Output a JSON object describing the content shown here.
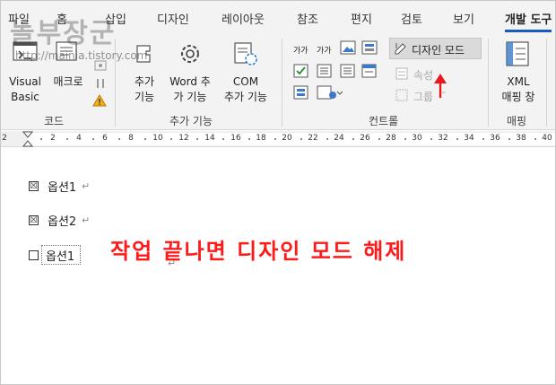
{
  "tabs": [
    "파일",
    "홈",
    "삽입",
    "디자인",
    "레이아웃",
    "참조",
    "편지",
    "검토",
    "보기",
    "개발 도구"
  ],
  "active_tab": "개발 도구",
  "watermark": {
    "title": "놀부장군",
    "url": "http://mainia.tistory.com"
  },
  "groups": {
    "code": {
      "label": "코드",
      "visual_basic": "Visual\nBasic",
      "macro": "매크로"
    },
    "addins": {
      "label": "추가 기능",
      "addins_btn": "추가\n기능",
      "word_addins_btn": "Word 추\n가 기능",
      "com_addins_btn": "COM\n추가 기능"
    },
    "controls": {
      "label": "컨트롤",
      "rich_text_1": "가가",
      "rich_text_2": "가가",
      "design_mode": "디자인 모드",
      "properties": "속성",
      "group": "그룹"
    },
    "mapping": {
      "label": "매핑",
      "xml_mapping": "XML\n매핑 창"
    }
  },
  "ruler": {
    "numbers": [
      "2",
      "2",
      "4",
      "6",
      "8",
      "10",
      "12",
      "14",
      "16",
      "18",
      "20",
      "22",
      "24",
      "26",
      "28",
      "30",
      "32",
      "34",
      "36",
      "38",
      "40"
    ]
  },
  "document": {
    "options": [
      {
        "label": "옵션1",
        "checked": true,
        "mark": "☒"
      },
      {
        "label": "옵션2",
        "checked": true,
        "mark": "☒"
      },
      {
        "label": "옵션1",
        "checked": false,
        "mark": ""
      }
    ],
    "para_mark": "↵",
    "annotation": "작업 끝나면 디자인 모드 해제"
  },
  "colors": {
    "accent": "#185abd",
    "annotation": "#ff1a1a",
    "arrow": "#e8191e"
  }
}
